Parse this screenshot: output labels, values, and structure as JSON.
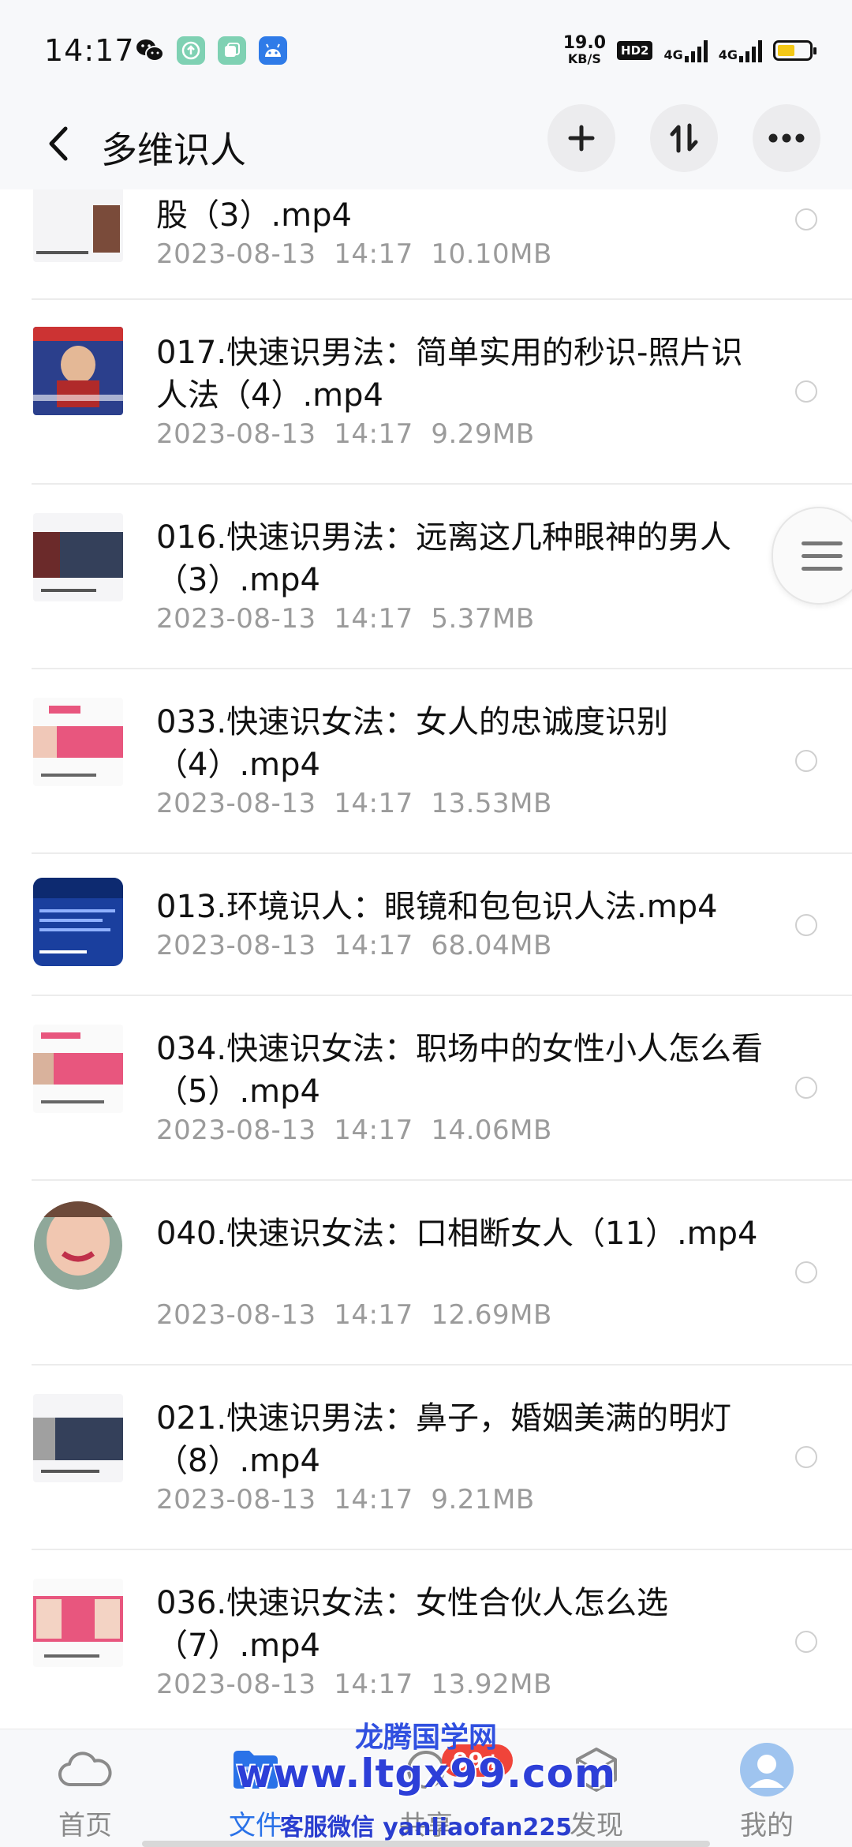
{
  "status_bar": {
    "time": "14:17",
    "net_speed_value": "19.0",
    "net_speed_unit": "KB/S",
    "hd_label": "HD2",
    "sig1_label": "4G",
    "sig2_label": "4G",
    "battery_level": 0.55
  },
  "header": {
    "title": "多维识人"
  },
  "files": [
    {
      "name": "股（3）.mp4",
      "date": "2023-08-13",
      "time": "14:17",
      "size": "10.10MB"
    },
    {
      "name": "017.快速识男法：简单实用的秒识-照片识人法（4）.mp4",
      "date": "2023-08-13",
      "time": "14:17",
      "size": "9.29MB"
    },
    {
      "name": "016.快速识男法：远离这几种眼神的男人（3）.mp4",
      "date": "2023-08-13",
      "time": "14:17",
      "size": "5.37MB"
    },
    {
      "name": "033.快速识女法：女人的忠诚度识别（4）.mp4",
      "date": "2023-08-13",
      "time": "14:17",
      "size": "13.53MB"
    },
    {
      "name": "013.环境识人：眼镜和包包识人法.mp4",
      "date": "2023-08-13",
      "time": "14:17",
      "size": "68.04MB"
    },
    {
      "name": "034.快速识女法：职场中的女性小人怎么看（5）.mp4",
      "date": "2023-08-13",
      "time": "14:17",
      "size": "14.06MB"
    },
    {
      "name": "040.快速识女法：口相断女人（11）.mp4",
      "date": "2023-08-13",
      "time": "14:17",
      "size": "12.69MB"
    },
    {
      "name": "021.快速识男法：鼻子，婚姻美满的明灯（8）.mp4",
      "date": "2023-08-13",
      "time": "14:17",
      "size": "9.21MB"
    },
    {
      "name": "036.快速识女法：女性合伙人怎么选（7）.mp4",
      "date": "2023-08-13",
      "time": "14:17",
      "size": "13.92MB"
    }
  ],
  "nav": {
    "home": "首页",
    "files": "文件",
    "share": "共享",
    "discover": "发现",
    "mine": "我的",
    "badge": "99+"
  },
  "watermark": {
    "line1": "龙腾国学网",
    "line2": "www.ltgx99.com",
    "line3": "客服微信 yanliaofan225"
  },
  "colors": {
    "accent": "#2a72e8",
    "badge": "#f0443a",
    "meta_text": "#9b9b9b",
    "watermark": "#2d3fd8"
  }
}
